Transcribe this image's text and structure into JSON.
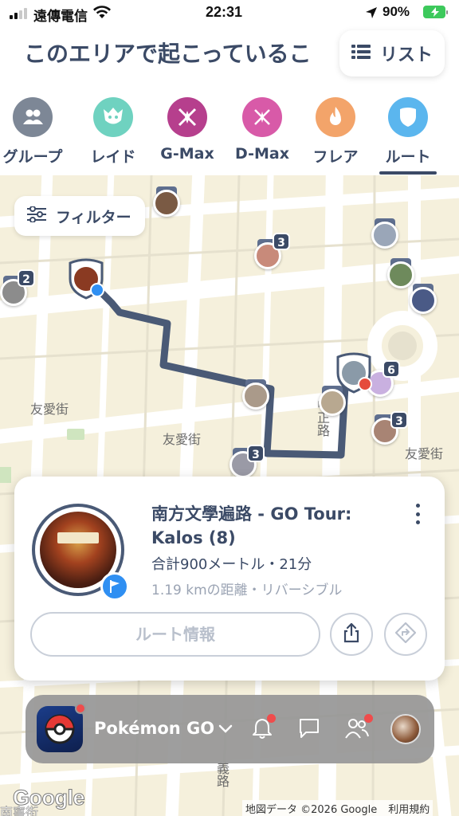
{
  "status_bar": {
    "carrier": "遠傳電信",
    "time": "22:31",
    "battery_percent": "90%"
  },
  "header": {
    "title": "このエリアで起こっているこ",
    "list_button_label": "リスト"
  },
  "tabs": [
    {
      "label": "グループ",
      "color": "#7d8796",
      "icon": "group-icon"
    },
    {
      "label": "レイド",
      "color": "#6fd2c0",
      "icon": "raid-icon"
    },
    {
      "label": "G-Max",
      "color": "#b63f8d",
      "icon": "gmax-icon"
    },
    {
      "label": "D-Max",
      "color": "#d85aa8",
      "icon": "dmax-icon"
    },
    {
      "label": "フレア",
      "color": "#f3a46a",
      "icon": "flare-icon"
    },
    {
      "label": "ルート",
      "color": "#5bb6ee",
      "icon": "route-icon",
      "active": true
    }
  ],
  "map": {
    "filter_label": "フィルター",
    "street_labels": [
      "友愛街",
      "友愛街",
      "友愛街",
      "中正路",
      "南寧街",
      "義路"
    ],
    "badges": [
      "3",
      "2",
      "6",
      "3",
      "3"
    ]
  },
  "route_card": {
    "title": "南方文學遍路 - GO Tour: Kalos (8)",
    "meta": "合計900メートル・21分",
    "sub": "1.19 kmの距離・リバーシブル",
    "route_info_button": "ルート情報"
  },
  "notification_bar": {
    "app_name": "Pokémon GO"
  },
  "footer": {
    "google_logo": "Google",
    "map_data": "地図データ ©2026 Google",
    "terms": "利用規約"
  }
}
